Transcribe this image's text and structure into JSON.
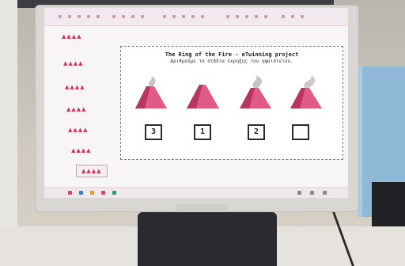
{
  "slide": {
    "title": "The Ring of the Fire - eTwinning project",
    "subtitle": "Αριθμούμε τα στάδια έκρηξης του ηφαιστείου."
  },
  "answer_boxes": [
    "3",
    "1",
    "2",
    ""
  ],
  "thumbnails": [
    {
      "label": "▲▲▲▲",
      "selected": false
    },
    {
      "label": "▲▲▲▲",
      "selected": false
    },
    {
      "label": "▲▲▲▲",
      "selected": false
    },
    {
      "label": "▲▲▲▲",
      "selected": false
    },
    {
      "label": "▲▲▲▲",
      "selected": false
    },
    {
      "label": "▲▲▲▲",
      "selected": false
    },
    {
      "label": "▲▲▲▲",
      "selected": true
    }
  ],
  "volcanoes": [
    {
      "icon": "volcano-icon",
      "smoke": true
    },
    {
      "icon": "volcano-icon",
      "smoke": false
    },
    {
      "icon": "volcano-icon",
      "smoke": true
    },
    {
      "icon": "volcano-icon",
      "smoke": true
    }
  ],
  "colors": {
    "volcano": "#e25a86",
    "volcano_dark": "#b8355f",
    "thumbnail_icons": "#d7335b"
  }
}
